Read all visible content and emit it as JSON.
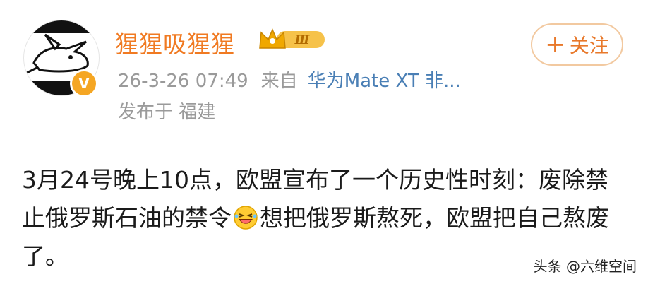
{
  "post": {
    "author": {
      "name": "猩猩吸猩猩",
      "rank_badge": "Ⅲ",
      "verified_mark": "V"
    },
    "meta": {
      "timestamp": "26-3-26 07:49",
      "from_label": "来自",
      "device": "华为Mate XT 非...",
      "location": "发布于 福建"
    },
    "follow_button": {
      "plus": "+",
      "label": "关注"
    },
    "text_part1": "3月24号晚上10点，欧盟宣布了一个历史性时刻：废除禁止俄罗斯石油的禁令",
    "text_part2": "想把俄罗斯熬死，欧盟把自己熬废了。",
    "emoji": "laughing-face-icon"
  },
  "watermark": "头条 @六维空间",
  "colors": {
    "username": "#f07a22",
    "meta": "#9a9a9a",
    "device_link": "#4a7fb5",
    "follow_border": "#f2c9a0",
    "follow_text": "#e8782a",
    "verified_badge": "#f5a623"
  }
}
